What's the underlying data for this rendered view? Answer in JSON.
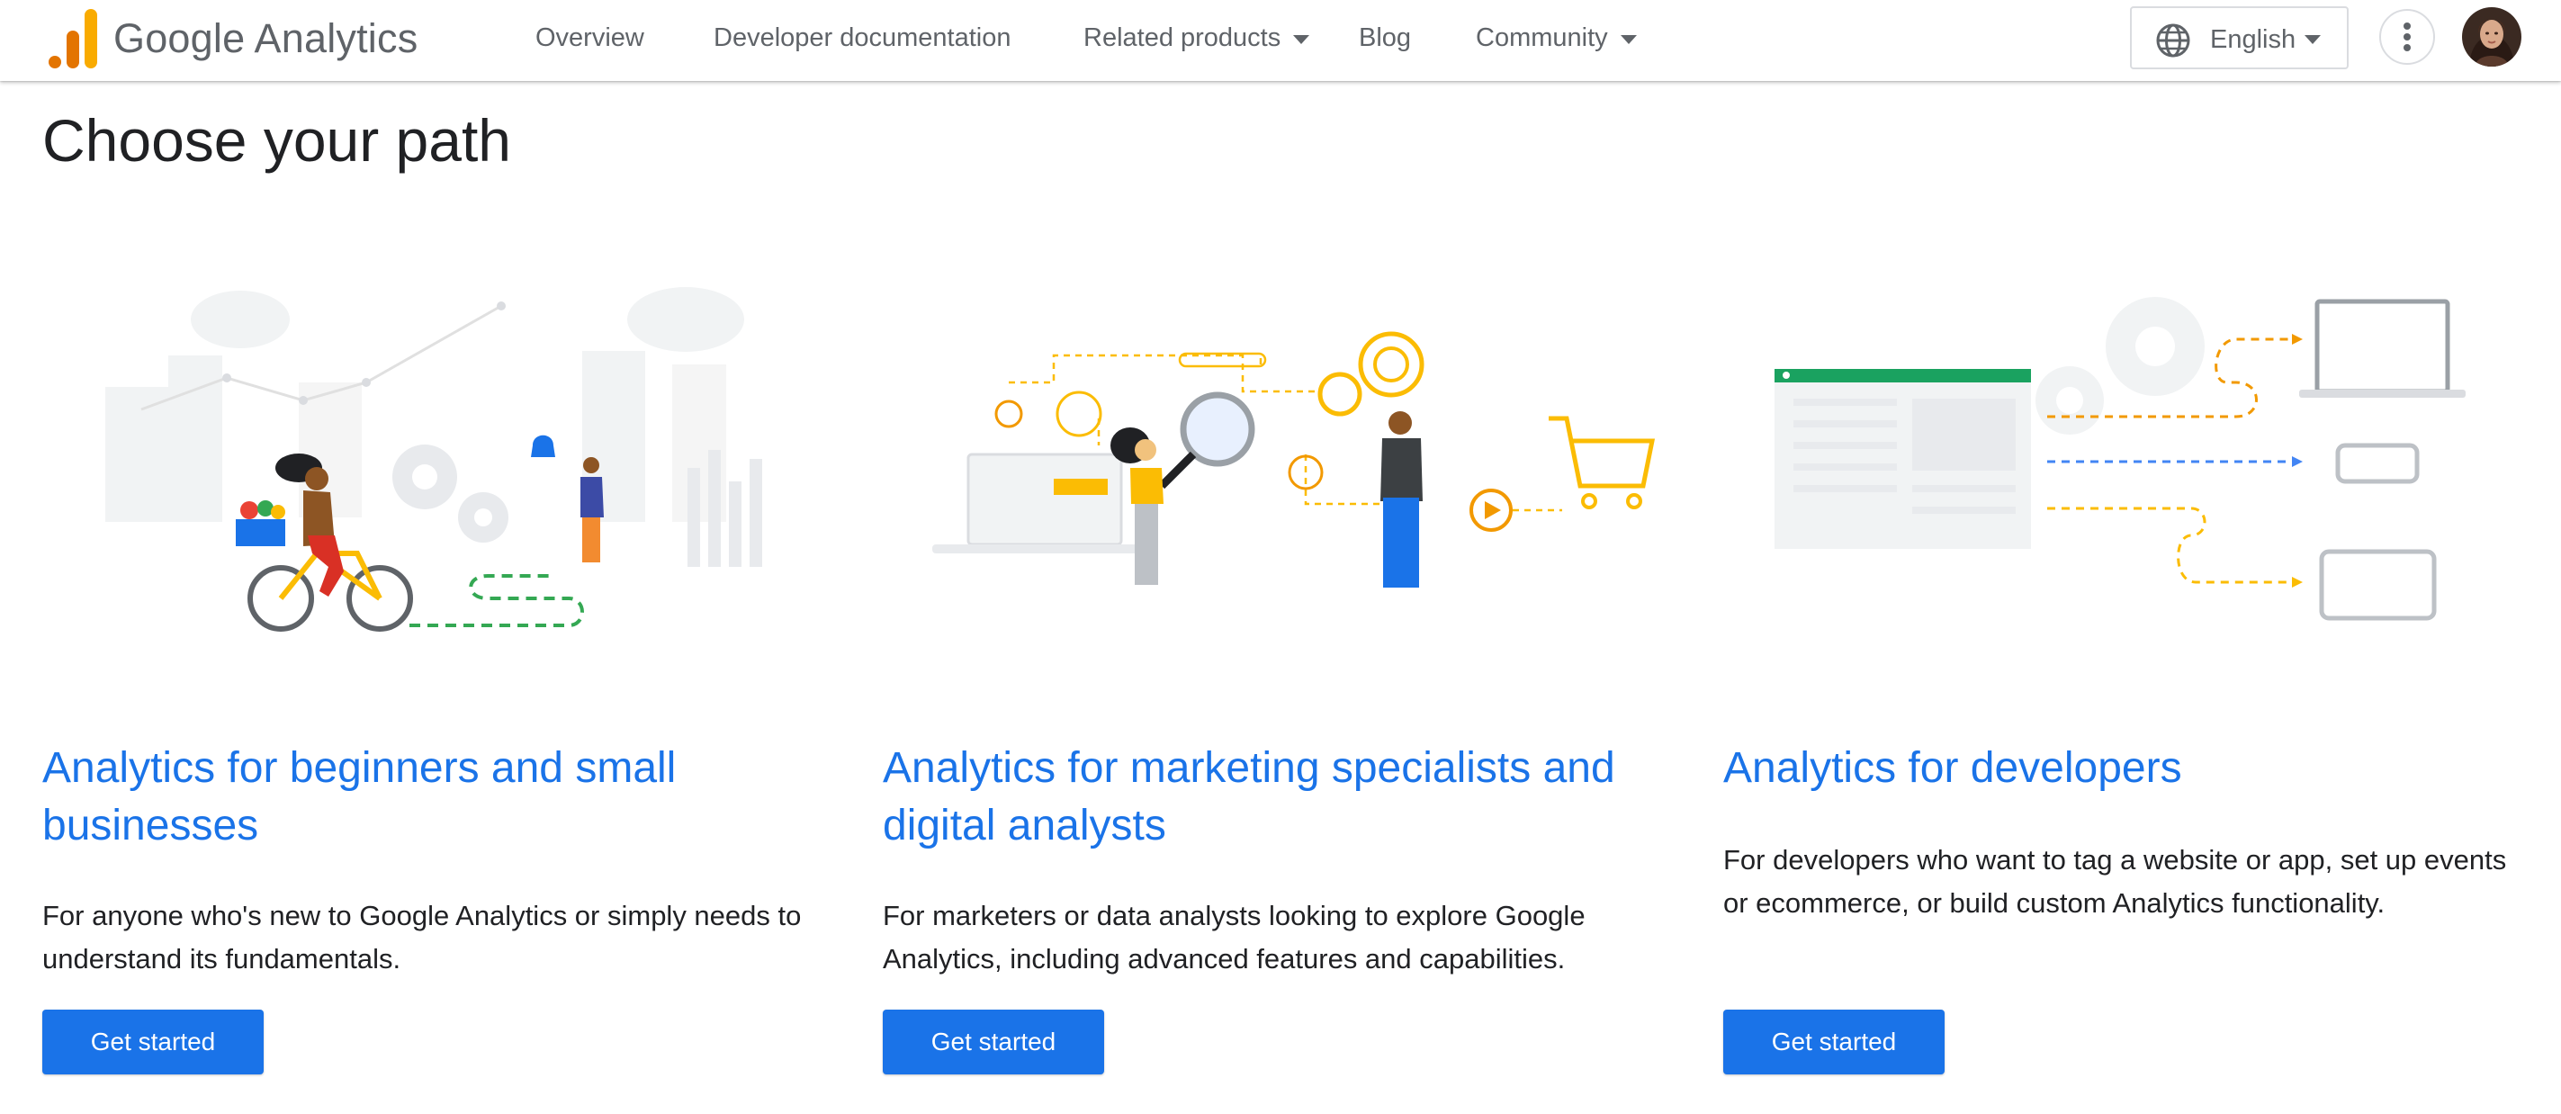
{
  "header": {
    "logo_text": "Google Analytics",
    "nav": [
      {
        "label": "Overview",
        "has_menu": false
      },
      {
        "label": "Developer documentation",
        "has_menu": false
      },
      {
        "label": "Related products",
        "has_menu": true
      },
      {
        "label": "Blog",
        "has_menu": false
      },
      {
        "label": "Community",
        "has_menu": true
      }
    ],
    "language": "English",
    "icons": {
      "language": "globe-icon",
      "more": "more-vert-icon",
      "account": "avatar"
    }
  },
  "page": {
    "title": "Choose your path"
  },
  "cards": [
    {
      "title": "Analytics for beginners and small businesses",
      "description": "For anyone who's new to Google Analytics or simply needs to understand its fundamentals.",
      "button": "Get started",
      "illustration": "cyclist-illustration"
    },
    {
      "title": "Analytics for marketing specialists and digital analysts",
      "description": "For marketers or data analysts looking to explore Google Analytics, including advanced features and capabilities.",
      "button": "Get started",
      "illustration": "analysts-illustration"
    },
    {
      "title": "Analytics for developers",
      "description": "For developers who want to tag a website or app, set up events or ecommerce, or build custom Analytics functionality.",
      "button": "Get started",
      "illustration": "devices-illustration"
    }
  ],
  "colors": {
    "accent": "#1a73e8",
    "text": "#202124",
    "muted": "#5f6368",
    "logo_orange": "#f9ab00",
    "logo_dark_orange": "#e37400"
  }
}
